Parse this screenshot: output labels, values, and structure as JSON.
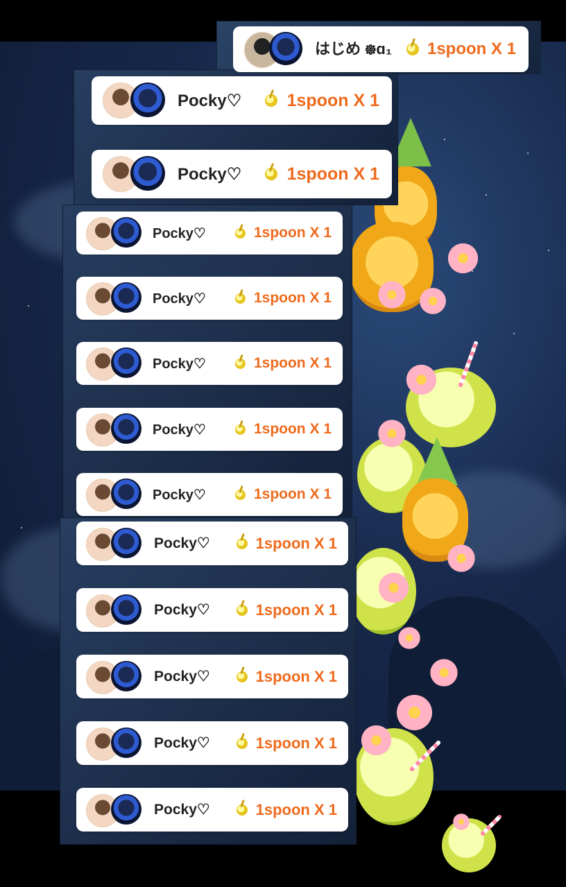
{
  "top_card": {
    "name": "はじめ ᪥ɑ₁",
    "gift": "1spoon X 1"
  },
  "cards": [
    {
      "name": "Pocky♡",
      "gift": "1spoon X 1"
    },
    {
      "name": "Pocky♡",
      "gift": "1spoon X 1"
    },
    {
      "name": "Pocky♡",
      "gift": "1spoon X 1"
    },
    {
      "name": "Pocky♡",
      "gift": "1spoon X 1"
    },
    {
      "name": "Pocky♡",
      "gift": "1spoon X 1"
    },
    {
      "name": "Pocky♡",
      "gift": "1spoon X 1"
    },
    {
      "name": "Pocky♡",
      "gift": "1spoon X 1"
    },
    {
      "name": "Pocky♡",
      "gift": "1spoon X 1"
    },
    {
      "name": "Pocky♡",
      "gift": "1spoon X 1"
    },
    {
      "name": "Pocky♡",
      "gift": "1spoon X 1"
    },
    {
      "name": "Pocky♡",
      "gift": "1spoon X 1"
    },
    {
      "name": "Pocky♡",
      "gift": "1spoon X 1"
    }
  ],
  "colors": {
    "gift_text": "#ee6a1c",
    "name_text": "#222222",
    "card_bg": "#ffffff"
  },
  "icons": {
    "gift": "spoon-icon",
    "avatar": "user-avatar"
  }
}
